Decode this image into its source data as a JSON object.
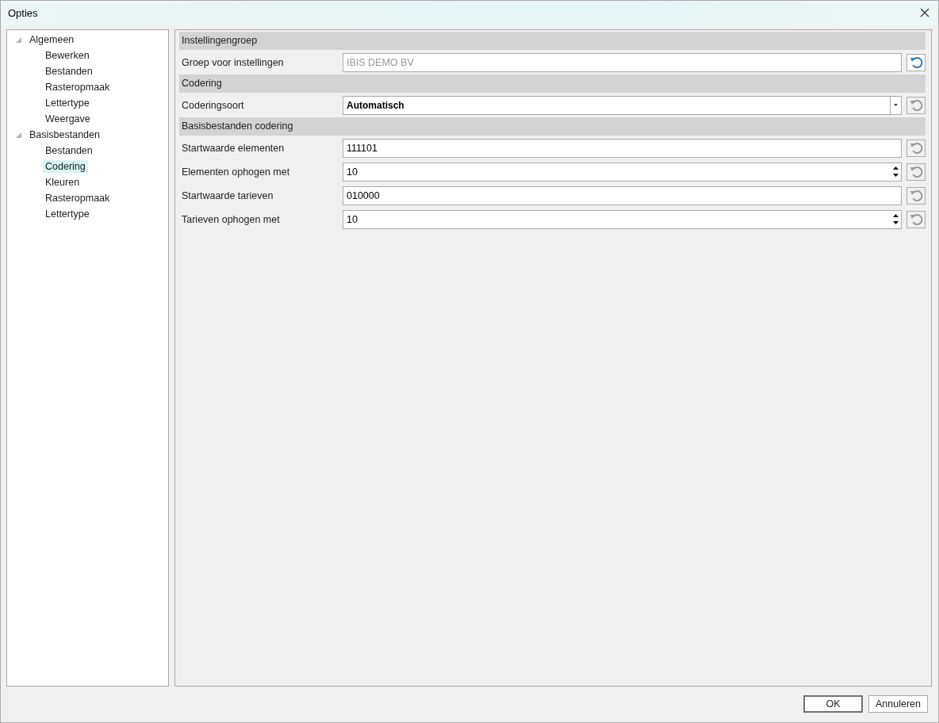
{
  "window": {
    "title": "Opties"
  },
  "tree": [
    {
      "label": "Algemeen",
      "expanded": true,
      "selected": false,
      "children": [
        {
          "label": "Bewerken",
          "selected": false
        },
        {
          "label": "Bestanden",
          "selected": false
        },
        {
          "label": "Rasteropmaak",
          "selected": false
        },
        {
          "label": "Lettertype",
          "selected": false
        },
        {
          "label": "Weergave",
          "selected": false
        }
      ]
    },
    {
      "label": "Basisbestanden",
      "expanded": true,
      "selected": false,
      "children": [
        {
          "label": "Bestanden",
          "selected": false
        },
        {
          "label": "Codering",
          "selected": true
        },
        {
          "label": "Kleuren",
          "selected": false
        },
        {
          "label": "Rasteropmaak",
          "selected": false
        },
        {
          "label": "Lettertype",
          "selected": false
        }
      ]
    }
  ],
  "sections": [
    {
      "title": "Instellingengroep",
      "rows": [
        {
          "label": "Groep voor instellingen",
          "kind": "text",
          "disabled": true,
          "value": "IBIS DEMO BV",
          "reset_enabled": true
        }
      ]
    },
    {
      "title": "Codering",
      "rows": [
        {
          "label": "Coderingsoort",
          "kind": "combo",
          "value": "Automatisch",
          "reset_enabled": false
        }
      ]
    },
    {
      "title": "Basisbestanden codering",
      "rows": [
        {
          "label": "Startwaarde elementen",
          "kind": "text",
          "value": "111101",
          "reset_enabled": false
        },
        {
          "label": "Elementen ophogen met",
          "kind": "spinner",
          "value": "10",
          "reset_enabled": false
        },
        {
          "label": "Startwaarde tarieven",
          "kind": "text",
          "value": "010000",
          "reset_enabled": false
        },
        {
          "label": "Tarieven ophogen met",
          "kind": "spinner",
          "value": "10",
          "reset_enabled": false
        }
      ]
    }
  ],
  "buttons": [
    {
      "label": "OK",
      "default": true
    },
    {
      "label": "Annuleren",
      "default": false
    }
  ]
}
